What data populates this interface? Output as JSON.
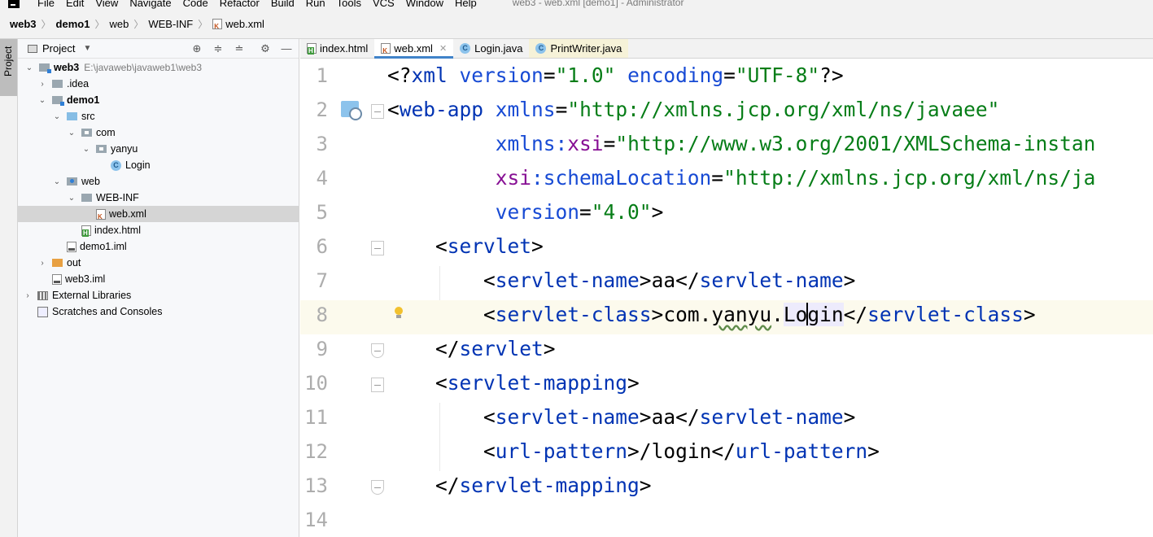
{
  "menu": {
    "items": [
      "File",
      "Edit",
      "View",
      "Navigate",
      "Code",
      "Refactor",
      "Build",
      "Run",
      "Tools",
      "VCS",
      "Window",
      "Help"
    ],
    "title": "web3 - web.xml [demo1] - Administrator"
  },
  "breadcrumb": [
    "web3",
    "demo1",
    "web",
    "WEB-INF",
    "web.xml"
  ],
  "toolstrip": {
    "project_tab": "Project"
  },
  "project": {
    "header_title": "Project",
    "tree": [
      {
        "label": "web3",
        "extra": "E:\\javaweb\\javaweb1\\web3"
      },
      {
        "label": ".idea"
      },
      {
        "label": "demo1"
      },
      {
        "label": "src"
      },
      {
        "label": "com"
      },
      {
        "label": "yanyu"
      },
      {
        "label": "Login"
      },
      {
        "label": "web"
      },
      {
        "label": "WEB-INF"
      },
      {
        "label": "web.xml"
      },
      {
        "label": "index.html"
      },
      {
        "label": "demo1.iml"
      },
      {
        "label": "out"
      },
      {
        "label": "web3.iml"
      },
      {
        "label": "External Libraries"
      },
      {
        "label": "Scratches and Consoles"
      }
    ]
  },
  "tabs": [
    {
      "label": "index.html"
    },
    {
      "label": "web.xml"
    },
    {
      "label": "Login.java"
    },
    {
      "label": "PrintWriter.java"
    }
  ],
  "editor": {
    "line_numbers": [
      "1",
      "2",
      "3",
      "4",
      "5",
      "6",
      "7",
      "8",
      "9",
      "10",
      "11",
      "12",
      "13",
      "14"
    ],
    "lines": [
      "<?xml version=\"1.0\" encoding=\"UTF-8\"?>",
      "<web-app xmlns=\"http://xmlns.jcp.org/xml/ns/javaee\"",
      "         xmlns:xsi=\"http://www.w3.org/2001/XMLSchema-instan",
      "         xsi:schemaLocation=\"http://xmlns.jcp.org/xml/ns/ja",
      "         version=\"4.0\">",
      "    <servlet>",
      "        <servlet-name>aa</servlet-name>",
      "        <servlet-class>com.yanyu.Login</servlet-class>",
      "    </servlet>",
      "    <servlet-mapping>",
      "        <servlet-name>aa</servlet-name>",
      "        <url-pattern>/login</url-pattern>",
      "    </servlet-mapping>",
      ""
    ]
  }
}
